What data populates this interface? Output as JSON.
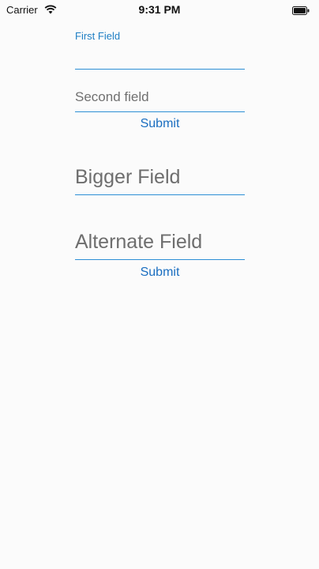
{
  "status_bar": {
    "carrier": "Carrier",
    "time": "9:31 PM",
    "wifi_icon": "wifi-icon",
    "battery_icon": "battery-icon"
  },
  "form": {
    "first_field": {
      "label": "First Field",
      "value": ""
    },
    "second_field": {
      "placeholder": "Second field",
      "value": ""
    },
    "submit_1_label": "Submit",
    "bigger_field": {
      "placeholder": "Bigger Field",
      "value": ""
    },
    "alternate_field": {
      "placeholder": "Alternate Field",
      "value": ""
    },
    "submit_2_label": "Submit"
  },
  "colors": {
    "accent": "#2d8fd5",
    "button_text": "#1a6ec0"
  }
}
